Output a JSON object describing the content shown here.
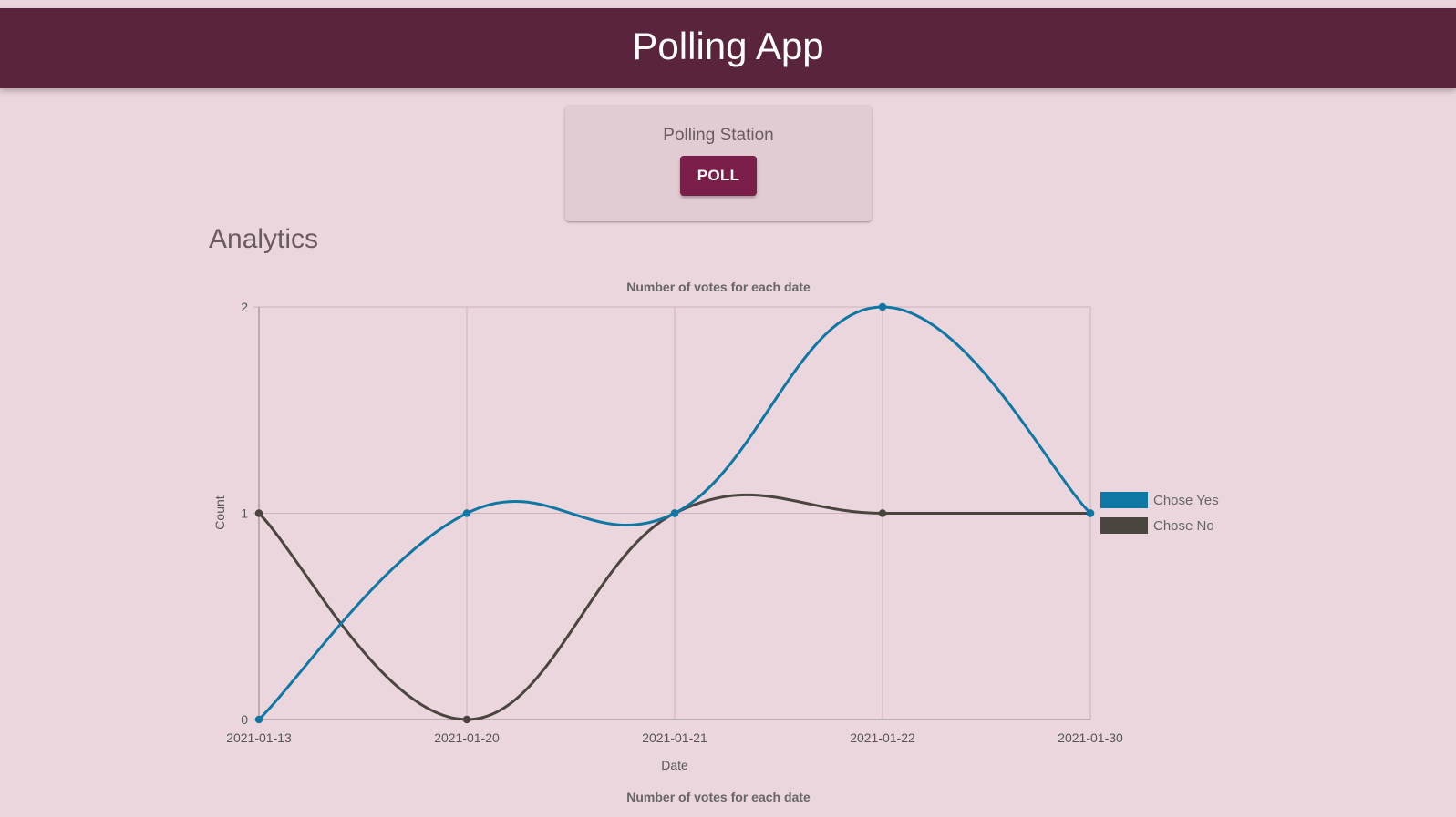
{
  "header": {
    "title": "Polling App",
    "background_color": "#5a243c"
  },
  "poll_card": {
    "title": "Polling Station",
    "button_label": "POLL",
    "button_color": "#7a1e4a"
  },
  "analytics": {
    "title": "Analytics",
    "second_chart_title": "Number of votes for each date"
  },
  "chart_data": {
    "type": "line",
    "title": "Number of votes for each date",
    "xlabel": "Date",
    "ylabel": "Count",
    "categories": [
      "2021-01-13",
      "2021-01-20",
      "2021-01-21",
      "2021-01-22",
      "2021-01-30"
    ],
    "ylim": [
      0,
      2
    ],
    "yticks": [
      0,
      1,
      2
    ],
    "grid": true,
    "curve": "smooth",
    "legend_position": "right",
    "series": [
      {
        "name": "Chose Yes",
        "values": [
          0,
          1,
          1,
          2,
          1
        ],
        "color": "#0f77a3"
      },
      {
        "name": "Chose No",
        "values": [
          1,
          0,
          1,
          1,
          1
        ],
        "color": "#4b4540"
      }
    ]
  }
}
